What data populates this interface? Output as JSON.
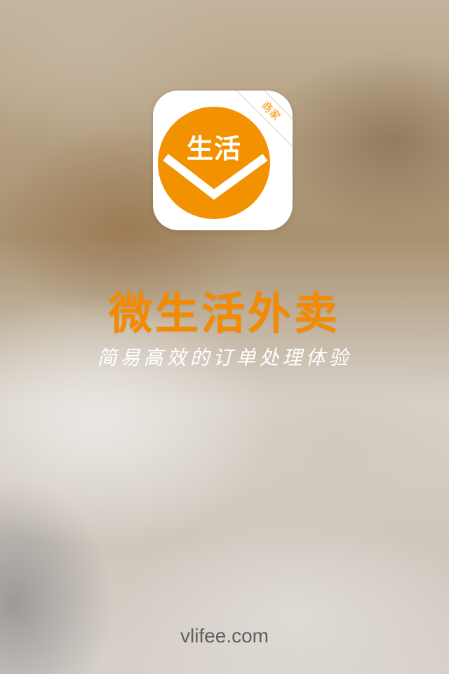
{
  "app_icon": {
    "icon_name": "app-logo-icon",
    "circle_text": "生活",
    "ribbon_text": "商家",
    "brand_color": "#f39200"
  },
  "title": "微生活外卖",
  "slogan": "简易高效的订单处理体验",
  "footer": {
    "website": "vlifee.com"
  }
}
